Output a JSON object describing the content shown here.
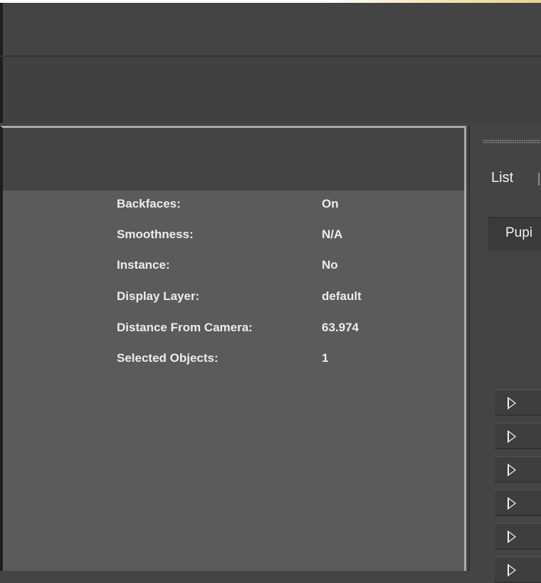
{
  "info": {
    "rows": [
      {
        "label": "Backfaces:",
        "value": "On"
      },
      {
        "label": "Smoothness:",
        "value": "N/A"
      },
      {
        "label": "Instance:",
        "value": "No"
      },
      {
        "label": "Display Layer:",
        "value": "default"
      },
      {
        "label": "Distance From Camera:",
        "value": "63.974"
      },
      {
        "label": "Selected Objects:",
        "value": "1"
      }
    ]
  },
  "right_panel": {
    "list_label": "List",
    "selector_text": "Pupi",
    "expanders": [
      {
        "icon": "triangle-right-icon"
      },
      {
        "icon": "triangle-right-icon"
      },
      {
        "icon": "triangle-right-icon"
      },
      {
        "icon": "triangle-right-icon"
      },
      {
        "icon": "triangle-right-icon"
      },
      {
        "icon": "triangle-right-icon"
      }
    ]
  },
  "colors": {
    "panel_bg": "#5b5b5b",
    "chrome_bg": "#444444",
    "text": "#ececec",
    "panel_border": "#a9a9a9"
  }
}
